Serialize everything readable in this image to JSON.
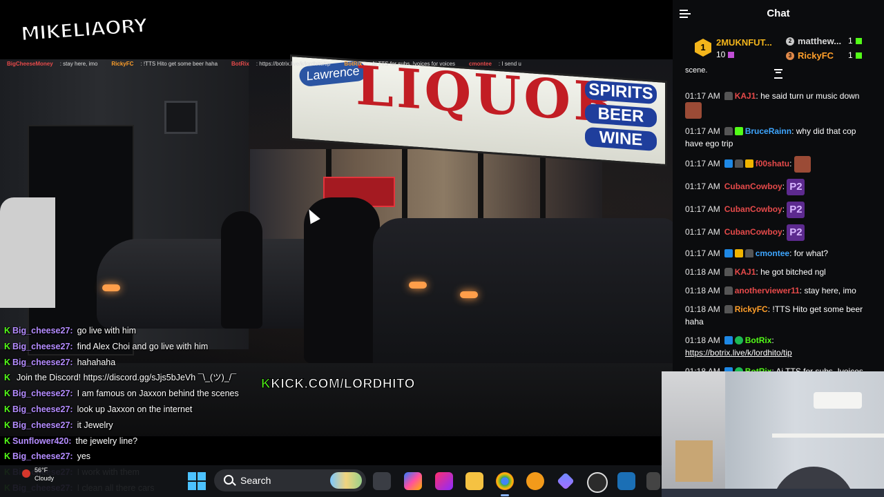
{
  "stream": {
    "logo_text": "MIKELIAORY",
    "watermark_k": "K",
    "watermark_text": "KICK.COM/LORDHITO",
    "ticker": [
      {
        "user": "BigCheeseMoney",
        "text": "stay here, imo"
      },
      {
        "user": "RickyFC",
        "text": "!TTS Hito get some beer haha"
      },
      {
        "user": "BotRix",
        "text": "https://botrix.live/k/lordhito/tip"
      },
      {
        "user": "BotRix",
        "text": "Ai TTS for subs. !voices for voices"
      },
      {
        "user": "cmontee",
        "text": "I send u"
      }
    ]
  },
  "overlay_chat": [
    {
      "user": "Big_cheese27",
      "color": "#b48cff",
      "text": "go live with him",
      "faded": false
    },
    {
      "user": "Big_cheese27",
      "color": "#b48cff",
      "text": "find Alex Choi and go live with him",
      "faded": false
    },
    {
      "user": "Big_cheese27",
      "color": "#b48cff",
      "text": "hahahaha",
      "faded": false
    },
    {
      "user": "",
      "color": "#ff4444",
      "text": "Join the Discord! https://discord.gg/sJjs5bJeVh ¯\\_(ツ)_/¯",
      "faded": false
    },
    {
      "user": "Big_cheese27",
      "color": "#b48cff",
      "text": "I am famous on Jaxxon behind the scenes",
      "faded": false
    },
    {
      "user": "Big_cheese27",
      "color": "#b48cff",
      "text": "look up Jaxxon on the internet",
      "faded": false
    },
    {
      "user": "Big_cheese27",
      "color": "#b48cff",
      "text": "it Jewelry",
      "faded": false
    },
    {
      "user": "Sunflower420",
      "color": "#b48cff",
      "text": "the jewelry line?",
      "faded": false
    },
    {
      "user": "Big_cheese27",
      "color": "#b48cff",
      "text": "yes",
      "faded": false
    },
    {
      "user": "Big_cheese27",
      "color": "#b48cff",
      "text": "I work with them",
      "faded": true
    },
    {
      "user": "Big_cheese27",
      "color": "#b48cff",
      "text": "I clean all there cars",
      "faded": true
    }
  ],
  "taskbar": {
    "weather": "56°F",
    "weather_sub": "Cloudy",
    "search_label": "Search"
  },
  "chat": {
    "title": "Chat",
    "leaderboard": {
      "first": {
        "rank": "1",
        "name": "2MUKNFUT...",
        "count": "10"
      },
      "second": {
        "rank": "2",
        "name": "matthew...",
        "count": "1"
      },
      "third": {
        "rank": "3",
        "name": "RickyFC",
        "count": "1"
      }
    },
    "partial_line": "scene.",
    "messages": [
      {
        "time": "01:17 AM",
        "badges": [
          "hat"
        ],
        "user": "KAJ1",
        "color": "#e64a4a",
        "text": "he said turn ur music down",
        "emote": "face"
      },
      {
        "time": "01:17 AM",
        "badges": [
          "hat",
          "gift"
        ],
        "user": "BruceRainn",
        "color": "#3ea6ff",
        "text": "why did that cop have ego trip",
        "emote": ""
      },
      {
        "time": "01:17 AM",
        "badges": [
          "sub",
          "hat",
          "crown"
        ],
        "user": "f00shatu",
        "color": "#e64a4a",
        "text": "",
        "emote": "face"
      },
      {
        "time": "01:17 AM",
        "badges": [],
        "user": "CubanCowboy",
        "color": "#e64a4a",
        "text": "",
        "emote": "p2"
      },
      {
        "time": "01:17 AM",
        "badges": [],
        "user": "CubanCowboy",
        "color": "#e64a4a",
        "text": "",
        "emote": "p2"
      },
      {
        "time": "01:17 AM",
        "badges": [],
        "user": "CubanCowboy",
        "color": "#e64a4a",
        "text": "",
        "emote": "p2"
      },
      {
        "time": "01:17 AM",
        "badges": [
          "sub",
          "crown",
          "hat"
        ],
        "user": "cmontee",
        "color": "#3ea6ff",
        "text": "for what?",
        "emote": ""
      },
      {
        "time": "01:18 AM",
        "badges": [
          "hat"
        ],
        "user": "KAJ1",
        "color": "#e64a4a",
        "text": "he got bitched ngl",
        "emote": ""
      },
      {
        "time": "01:18 AM",
        "badges": [
          "hat"
        ],
        "user": "anotherviewer11",
        "color": "#e64a4a",
        "text": "stay here, imo",
        "emote": ""
      },
      {
        "time": "01:18 AM",
        "badges": [
          "hat"
        ],
        "user": "RickyFC",
        "color": "#ff9f2a",
        "text": "!TTS Hito get some beer haha",
        "emote": ""
      },
      {
        "time": "01:18 AM",
        "badges": [
          "sub",
          "verified"
        ],
        "user": "BotRix",
        "color": "#53fc18",
        "text": "https://botrix.live/k/lordhito/tip",
        "emote": ""
      },
      {
        "time": "01:18 AM",
        "badges": [
          "sub",
          "verified"
        ],
        "user": "BotRix",
        "color": "#53fc18",
        "text": "Ai TTS for subs. !voices for voices",
        "emote": ""
      }
    ]
  }
}
